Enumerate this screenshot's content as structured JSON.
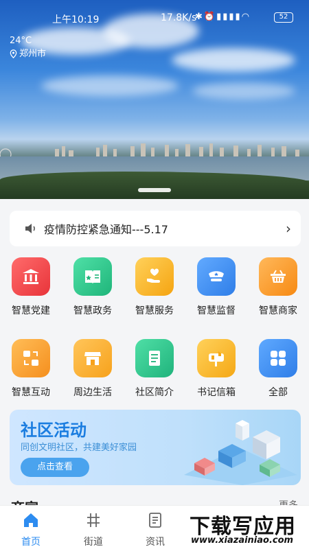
{
  "status_bar": {
    "time": "上午10:19",
    "network_speed": "17.8K/s",
    "icons": [
      "bluetooth-icon",
      "alarm-icon",
      "hd-signal-icon",
      "hd-signal-icon",
      "wifi-icon"
    ],
    "battery": "52"
  },
  "weather": {
    "temperature": "24°C",
    "city": "郑州市"
  },
  "banner_image": {
    "description_icon": "city-lake-landscape"
  },
  "notice": {
    "text": "疫情防控紧急通知---5.17",
    "icon": "speaker-icon"
  },
  "grid": [
    {
      "label": "智慧党建",
      "icon": "building-icon",
      "color": "#ee4548"
    },
    {
      "label": "智慧政务",
      "icon": "book-icon",
      "color": "#2ec58c"
    },
    {
      "label": "智慧服务",
      "icon": "heart-hand-icon",
      "color": "#f7b52a"
    },
    {
      "label": "智慧监督",
      "icon": "police-hat-icon",
      "color": "#3b8ef0"
    },
    {
      "label": "智慧商家",
      "icon": "basket-icon",
      "color": "#fb9a2a"
    },
    {
      "label": "智慧互动",
      "icon": "exchange-icon",
      "color": "#fba437"
    },
    {
      "label": "周边生活",
      "icon": "shop-icon",
      "color": "#fbab2e"
    },
    {
      "label": "社区简介",
      "icon": "document-icon",
      "color": "#35c48f"
    },
    {
      "label": "书记信箱",
      "icon": "mailbox-icon",
      "color": "#fbb731"
    },
    {
      "label": "全部",
      "icon": "grid-icon",
      "color": "#3c90f2"
    }
  ],
  "activity_banner": {
    "title": "社区活动",
    "subtitle": "同创文明社区，共建美好家园",
    "button": "点击查看"
  },
  "section": {
    "title": "商家",
    "more": "更多"
  },
  "tabs": [
    {
      "label": "首页",
      "icon": "home-icon",
      "active": true
    },
    {
      "label": "街道",
      "icon": "street-icon",
      "active": false
    },
    {
      "label": "资讯",
      "icon": "news-icon",
      "active": false
    }
  ],
  "watermark": {
    "big": "下载写应用",
    "small": "www.xiazainiao.com"
  }
}
